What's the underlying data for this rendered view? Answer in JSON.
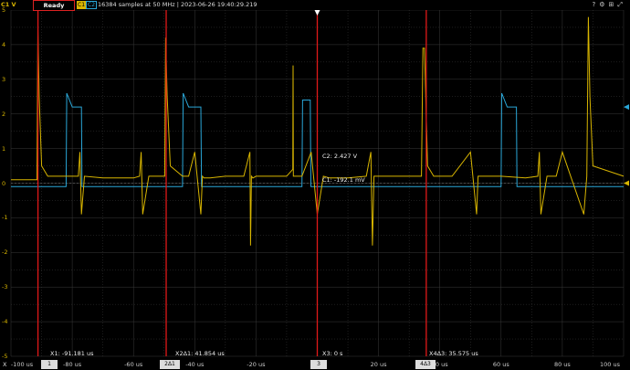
{
  "top_bar": {
    "channel_unit": "C1 V",
    "status": "Ready",
    "c1_chip": "C1",
    "c2_chip": "C2",
    "acquisition_info": "16384 samples at 50 MHz | 2023-06-26 19:40:29.219",
    "icons": [
      "help-icon",
      "settings-icon",
      "network-icon",
      "fullscreen-icon"
    ]
  },
  "y_axis": {
    "labels": [
      "5",
      "4",
      "3",
      "2",
      "1",
      "0",
      "-1",
      "-2",
      "-3",
      "-4",
      "-5"
    ]
  },
  "x_axis": {
    "axis_button": "X",
    "labels": [
      "-100 us",
      "-80 us",
      "-60 us",
      "-40 us",
      "-20 us",
      "0 us",
      "20 us",
      "40 us",
      "60 us",
      "80 us",
      "100 us"
    ]
  },
  "cursors": [
    {
      "label": "X1: -91.181 us",
      "box": "1"
    },
    {
      "label": "X2Δ1: 41.854 us",
      "box": "2Δ1"
    },
    {
      "label": "X3: 0 s",
      "box": "3"
    },
    {
      "label": "X4Δ3: 35.575 us",
      "box": "4Δ3"
    }
  ],
  "measurements": {
    "c2": "C2: 2.427 V",
    "c1": "C1: -192.1 mV"
  },
  "colors": {
    "ch1": "#d8b500",
    "ch2": "#2aa7d8",
    "cursor": "#e01818",
    "grid": "#3a3a3a"
  },
  "chart_data": {
    "type": "line",
    "xlabel": "",
    "ylabel": "V",
    "xlim": [
      -100,
      100
    ],
    "ylim": [
      -5,
      5
    ],
    "x_unit": "us",
    "grid": true,
    "series": [
      {
        "name": "C1",
        "color": "#d8b500",
        "x": [
          -100,
          -91.5,
          -91.2,
          -90.8,
          -90,
          -88,
          -80,
          -78,
          -77.5,
          -77,
          -76,
          -70,
          -60,
          -58,
          -57.5,
          -57,
          -55,
          -50,
          -49.8,
          -49.5,
          -49,
          -48,
          -44,
          -42,
          -40,
          -38,
          -37.5,
          -37,
          -35,
          -30,
          -24,
          -22,
          -21.8,
          -21.5,
          -21,
          -20,
          -10,
          -8,
          -7.9,
          -7.8,
          -5,
          -2,
          0,
          2,
          4,
          6,
          10,
          16,
          17.5,
          18,
          18.5,
          20,
          30,
          34,
          34.5,
          35,
          36,
          38,
          44,
          50,
          52,
          52.5,
          53,
          55,
          60,
          68,
          72,
          72.5,
          73,
          75,
          76,
          78,
          80,
          87,
          88,
          88.5,
          89,
          90,
          100
        ],
        "y": [
          0.1,
          0.1,
          4.5,
          2.5,
          0.5,
          0.2,
          0.2,
          0.2,
          0.9,
          -0.9,
          0.2,
          0.15,
          0.15,
          0.2,
          0.9,
          -0.9,
          0.2,
          0.2,
          0.2,
          4.2,
          2.5,
          0.5,
          0.2,
          0.2,
          0.9,
          -0.9,
          0.2,
          0.15,
          0.15,
          0.2,
          0.2,
          0.9,
          -1.8,
          0.2,
          0.15,
          0.2,
          0.2,
          0.4,
          3.4,
          0.2,
          0.2,
          0.9,
          -0.9,
          0.2,
          0.15,
          0.15,
          0.15,
          0.2,
          0.9,
          -1.8,
          0.2,
          0.2,
          0.2,
          0.2,
          3.9,
          3.9,
          0.5,
          0.2,
          0.2,
          0.9,
          -0.9,
          0.2,
          0.2,
          0.2,
          0.2,
          0.15,
          0.2,
          0.9,
          -0.9,
          0.2,
          0.2,
          0.2,
          0.9,
          -0.9,
          0.2,
          4.8,
          2.5,
          0.5,
          0.2
        ]
      },
      {
        "name": "C2",
        "color": "#2aa7d8",
        "x": [
          -100,
          -82,
          -81.8,
          -80,
          -77,
          -76.8,
          -70,
          -60,
          -44,
          -43.8,
          -42,
          -38,
          -37.8,
          -30,
          -21,
          -20,
          -10,
          -5,
          -4.8,
          -2.3,
          -2.1,
          0,
          4,
          6,
          10,
          20,
          35,
          40,
          60,
          60.2,
          62,
          65,
          65.2,
          70,
          80,
          100
        ],
        "y": [
          -0.1,
          -0.1,
          2.6,
          2.2,
          2.2,
          -0.1,
          -0.1,
          -0.1,
          -0.1,
          2.6,
          2.2,
          2.2,
          -0.1,
          -0.1,
          -0.1,
          -0.1,
          -0.1,
          -0.1,
          2.4,
          2.4,
          -0.1,
          -0.1,
          -0.1,
          -0.1,
          -0.1,
          -0.1,
          -0.1,
          -0.1,
          -0.1,
          2.6,
          2.2,
          2.2,
          -0.1,
          -0.1,
          -0.1,
          -0.1
        ]
      }
    ],
    "cursors_x": [
      -91.181,
      -49.327,
      0,
      35.575
    ]
  }
}
